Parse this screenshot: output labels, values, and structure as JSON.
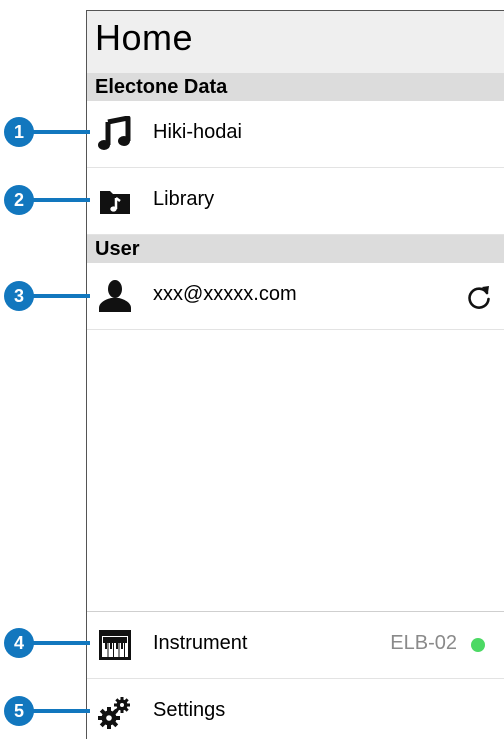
{
  "header": {
    "title": "Home"
  },
  "sections": {
    "electone": {
      "title": "Electone Data"
    },
    "user": {
      "title": "User"
    }
  },
  "items": {
    "hiki_hodai": {
      "label": "Hiki-hodai",
      "icon": "music-note-icon"
    },
    "library": {
      "label": "Library",
      "icon": "folder-music-icon"
    },
    "account": {
      "label": "xxx@xxxxx.com",
      "icon": "user-icon",
      "action_icon": "refresh-icon"
    },
    "instrument": {
      "label": "Instrument",
      "value": "ELB-02",
      "status_color": "#4cd964",
      "icon": "keyboard-icon"
    },
    "settings": {
      "label": "Settings",
      "icon": "gears-icon"
    }
  },
  "callouts": [
    "1",
    "2",
    "3",
    "4",
    "5"
  ],
  "colors": {
    "callout": "#1277be",
    "connected": "#4cd964"
  }
}
